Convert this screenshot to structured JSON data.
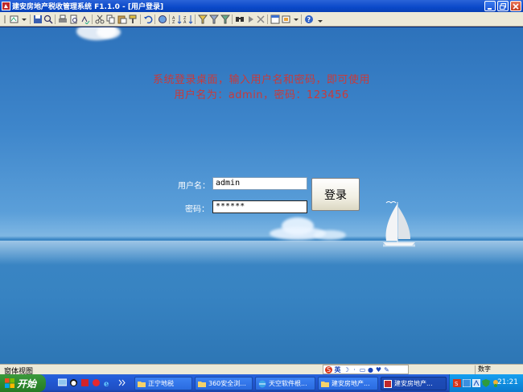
{
  "window": {
    "title": "建安房地产税收管理系统 F1.1.0 - [用户登录]"
  },
  "notice": {
    "line1": "系统登录桌面，输入用户名和密码，即可使用",
    "line2": "用户名为：admin，密码：123456"
  },
  "login": {
    "username_label": "用户名：",
    "username_value": "admin",
    "password_label": "密码：",
    "password_value": "******",
    "submit_label": "登录"
  },
  "statusbar": {
    "left_text": "窗体视图",
    "ime_label": "英",
    "right_text": "数字"
  },
  "taskbar": {
    "start_label": "开始",
    "buttons": [
      {
        "label": "正宁地税"
      },
      {
        "label": "360安全浏..."
      },
      {
        "label": "天空软件根..."
      },
      {
        "label": "建安房地产..."
      },
      {
        "label": "建安房地产..."
      }
    ],
    "clock": "21:21"
  },
  "colors": {
    "notice": "#c93a3a",
    "titlebar": "#0a49c9",
    "taskbar": "#245edb",
    "start": "#2e8a2e"
  }
}
